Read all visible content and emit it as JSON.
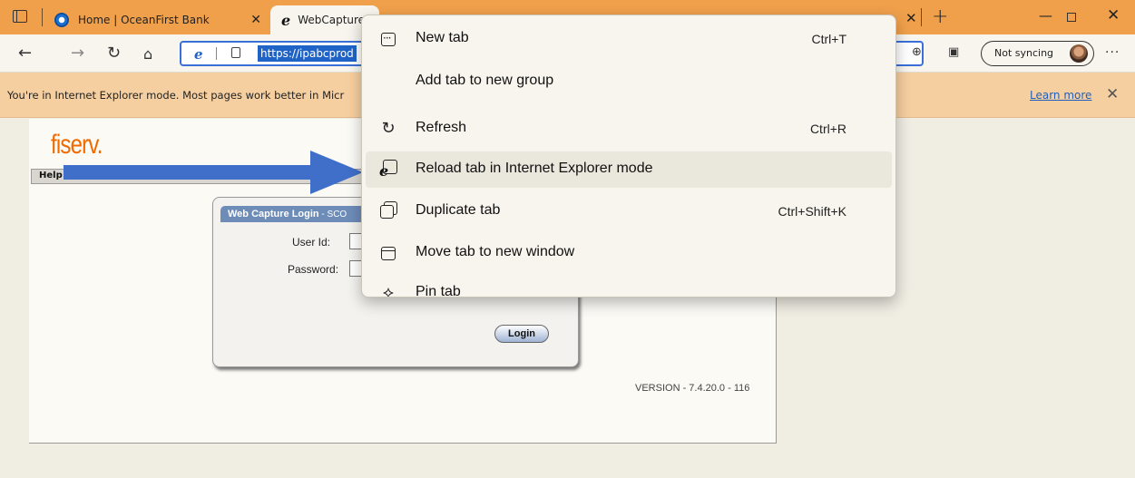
{
  "tabs": [
    {
      "label": "Home | OceanFirst Bank",
      "active": false
    },
    {
      "label": "WebCapture",
      "active": true
    }
  ],
  "address": {
    "url": "https://ipabcprod"
  },
  "toolbar": {
    "sync_label": "Not syncing"
  },
  "infobar": {
    "message": "You're in Internet Explorer mode. Most pages work better in Micr",
    "learn_more": "Learn more"
  },
  "page": {
    "logo_text": "fiserv.",
    "menu_help": "Help",
    "login": {
      "title": "Web Capture Login",
      "title_suffix": " - SCO",
      "user_label": "User Id:",
      "password_label": "Password:",
      "button_label": "Login"
    },
    "version": "VERSION - 7.4.20.0 - 116"
  },
  "context_menu": {
    "items": [
      {
        "label": "New tab",
        "shortcut": "Ctrl+T",
        "icon": "new-tab-icon"
      },
      {
        "label": "Add tab to new group",
        "shortcut": "",
        "icon": ""
      },
      {
        "label": "Refresh",
        "shortcut": "Ctrl+R",
        "icon": "refresh-icon"
      },
      {
        "label": "Reload tab in Internet Explorer mode",
        "shortcut": "",
        "icon": "ie-mode-icon",
        "hovered": true
      },
      {
        "label": "Duplicate tab",
        "shortcut": "Ctrl+Shift+K",
        "icon": "duplicate-icon"
      },
      {
        "label": "Move tab to new window",
        "shortcut": "",
        "icon": "window-icon"
      },
      {
        "label": "Pin tab",
        "shortcut": "",
        "icon": "pin-icon"
      }
    ]
  },
  "colors": {
    "tabstrip": "#f0a04b",
    "infobar": "#f6cfa0",
    "accent": "#1f63c7",
    "arrow": "#3f6fc8",
    "logo": "#ef6a00"
  }
}
